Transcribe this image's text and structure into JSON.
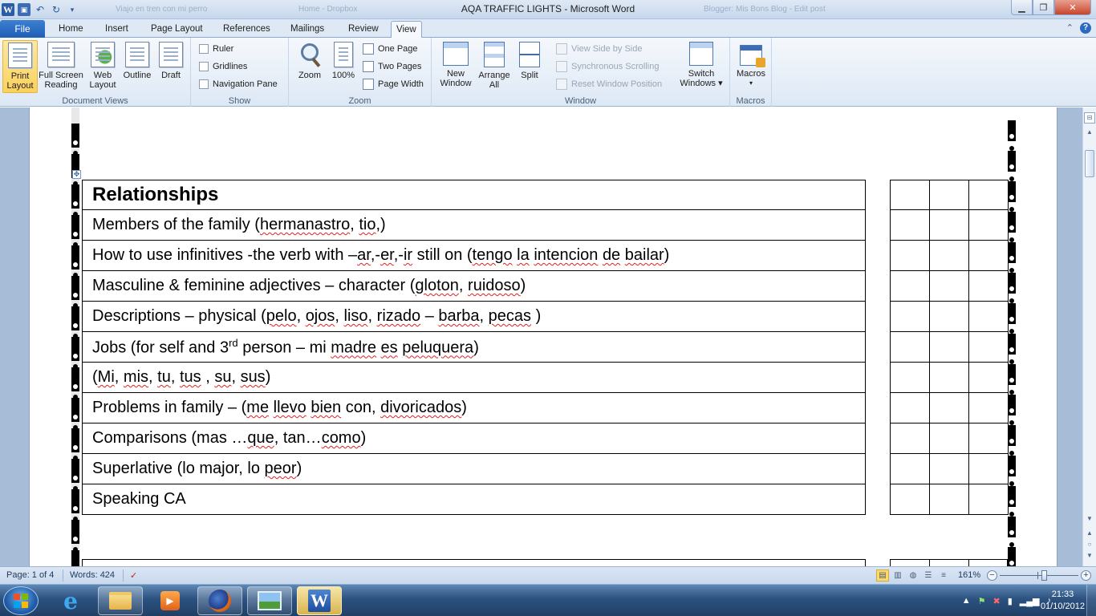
{
  "window": {
    "title": "AQA TRAFFIC LIGHTS  -  Microsoft Word",
    "background_tabs": [
      "Viajo en tren con mi perro",
      "Home - Dropbox",
      "Blogger: Mis Bons Blog - Edit post"
    ],
    "controls": [
      "minimize",
      "maximize",
      "close"
    ]
  },
  "ribbon_tabs": {
    "file": "File",
    "tabs": [
      "Home",
      "Insert",
      "Page Layout",
      "References",
      "Mailings",
      "Review",
      "View"
    ],
    "active": "View"
  },
  "ribbon": {
    "document_views": {
      "label": "Document Views",
      "print_layout": "Print Layout",
      "print_layout_l1": "Print",
      "print_layout_l2": "Layout",
      "full_l1": "Full Screen",
      "full_l2": "Reading",
      "web_l1": "Web",
      "web_l2": "Layout",
      "outline": "Outline",
      "draft": "Draft"
    },
    "show": {
      "label": "Show",
      "ruler": "Ruler",
      "gridlines": "Gridlines",
      "navigation_pane": "Navigation Pane"
    },
    "zoom": {
      "label": "Zoom",
      "zoom": "Zoom",
      "hundred": "100%",
      "one_page": "One Page",
      "two_pages": "Two Pages",
      "page_width": "Page Width"
    },
    "window": {
      "label": "Window",
      "new_l1": "New",
      "new_l2": "Window",
      "arrange_l1": "Arrange",
      "arrange_l2": "All",
      "split": "Split",
      "side_by_side": "View Side by Side",
      "sync_scrolling": "Synchronous Scrolling",
      "reset_position": "Reset Window Position",
      "switch_l1": "Switch",
      "switch_l2": "Windows ▾"
    },
    "macros": {
      "label": "Macros",
      "macros": "Macros"
    }
  },
  "document": {
    "heading": "Relationships",
    "rows": [
      [
        {
          "t": "Members of the family  ("
        },
        {
          "t": "hermanastro",
          "sq": true
        },
        {
          "t": ", "
        },
        {
          "t": "tio",
          "sq": true
        },
        {
          "t": ",)"
        }
      ],
      [
        {
          "t": "How to use infinitives -the verb with –"
        },
        {
          "t": "ar",
          "sq": true
        },
        {
          "t": ",-"
        },
        {
          "t": "er",
          "sq": true
        },
        {
          "t": ",-"
        },
        {
          "t": "ir",
          "sq": true
        },
        {
          "t": " still on  ("
        },
        {
          "t": "tengo",
          "sq": true
        },
        {
          "t": " "
        },
        {
          "t": "la",
          "sq": true
        },
        {
          "t": " "
        },
        {
          "t": "intencion",
          "sq": true
        },
        {
          "t": " "
        },
        {
          "t": "de",
          "sq": true
        },
        {
          "t": " "
        },
        {
          "t": "bailar",
          "sq": true
        },
        {
          "t": ")"
        }
      ],
      [
        {
          "t": "Masculine & feminine adjectives – character ("
        },
        {
          "t": "gloton",
          "sq": true
        },
        {
          "t": ", "
        },
        {
          "t": "ruidoso",
          "sq": true
        },
        {
          "t": ")"
        }
      ],
      [
        {
          "t": "Descriptions – physical ("
        },
        {
          "t": "pelo",
          "sq": true
        },
        {
          "t": ", "
        },
        {
          "t": "ojos",
          "sq": true
        },
        {
          "t": ", "
        },
        {
          "t": "liso",
          "sq": true
        },
        {
          "t": ", "
        },
        {
          "t": "rizado",
          "sq": true
        },
        {
          "t": " – "
        },
        {
          "t": "barba",
          "sq": true
        },
        {
          "t": ", "
        },
        {
          "t": "pecas",
          "sq": true
        },
        {
          "t": " )"
        }
      ],
      [
        {
          "t": "Jobs  (for self and 3"
        },
        {
          "t": "rd",
          "sup": true
        },
        {
          "t": " person – mi "
        },
        {
          "t": "madre",
          "sq": true
        },
        {
          "t": " "
        },
        {
          "t": "es",
          "sq": true
        },
        {
          "t": " "
        },
        {
          "t": "peluquera",
          "sq": true
        },
        {
          "t": ")"
        }
      ],
      [
        {
          "t": "("
        },
        {
          "t": "Mi",
          "sq": true
        },
        {
          "t": ", "
        },
        {
          "t": "mis",
          "sq": true
        },
        {
          "t": ", "
        },
        {
          "t": "tu",
          "sq": true
        },
        {
          "t": ", "
        },
        {
          "t": "tus",
          "sq": true
        },
        {
          "t": " , "
        },
        {
          "t": "su",
          "sq": true
        },
        {
          "t": ", "
        },
        {
          "t": "sus",
          "sq": true
        },
        {
          "t": ")"
        }
      ],
      [
        {
          "t": "Problems in family – ("
        },
        {
          "t": "me",
          "sq": true
        },
        {
          "t": " "
        },
        {
          "t": "llevo",
          "sq": true
        },
        {
          "t": " "
        },
        {
          "t": "bien",
          "sq": true
        },
        {
          "t": " con, "
        },
        {
          "t": "divoricados",
          "sq": true
        },
        {
          "t": ")"
        }
      ],
      [
        {
          "t": "Comparisons (mas …"
        },
        {
          "t": "que",
          "sq": true
        },
        {
          "t": ", tan…"
        },
        {
          "t": "como",
          "sq": true
        },
        {
          "t": ")"
        }
      ],
      [
        {
          "t": "Superlative (lo major, lo "
        },
        {
          "t": "peor",
          "sq": true
        },
        {
          "t": ")"
        }
      ],
      [
        {
          "t": "Speaking CA"
        }
      ]
    ]
  },
  "status_bar": {
    "page": "Page: 1 of 4",
    "words": "Words: 424",
    "zoom": "161%",
    "zoom_level_percent": 161
  },
  "taskbar": {
    "time": "21:33",
    "date": "01/10/2012"
  }
}
